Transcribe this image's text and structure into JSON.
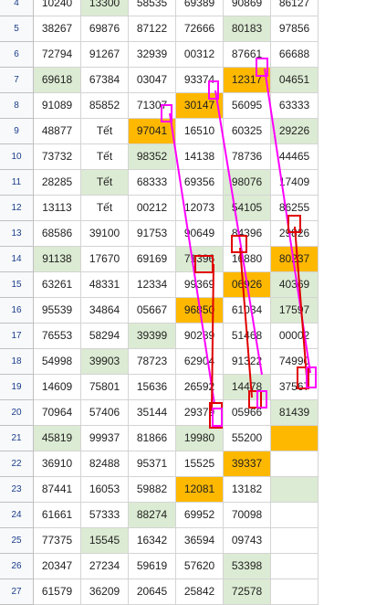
{
  "row_numbers": [
    "4",
    "5",
    "6",
    "7",
    "8",
    "9",
    "10",
    "11",
    "12",
    "13",
    "14",
    "15",
    "16",
    "17",
    "18",
    "19",
    "20",
    "21",
    "22",
    "23",
    "24",
    "25",
    "26",
    "27"
  ],
  "rows": [
    [
      "10240",
      "13300",
      "58535",
      "69389",
      "90869",
      "86127"
    ],
    [
      "38267",
      "69876",
      "87122",
      "72666",
      "80183",
      "97856"
    ],
    [
      "72794",
      "91267",
      "32939",
      "00312",
      "87661",
      "66688"
    ],
    [
      "69618",
      "67384",
      "03047",
      "93374",
      "12317",
      "04651"
    ],
    [
      "91089",
      "85852",
      "71307",
      "30147",
      "56095",
      "63333"
    ],
    [
      "48877",
      "Tết",
      "97041",
      "16510",
      "60325",
      "29226"
    ],
    [
      "73732",
      "Tết",
      "98352",
      "14138",
      "78736",
      "44465"
    ],
    [
      "28285",
      "Tết",
      "68333",
      "69356",
      "98076",
      "17409"
    ],
    [
      "13113",
      "Tết",
      "00212",
      "12073",
      "54105",
      "86255"
    ],
    [
      "68586",
      "39100",
      "91753",
      "90649",
      "84396",
      "29826"
    ],
    [
      "91138",
      "17670",
      "69169",
      "71396",
      "16880",
      "80237"
    ],
    [
      "63261",
      "48331",
      "12334",
      "99369",
      "06926",
      "40369"
    ],
    [
      "95539",
      "34864",
      "05667",
      "96850",
      "61034",
      "17597"
    ],
    [
      "76553",
      "58294",
      "39399",
      "90289",
      "51468",
      "00002"
    ],
    [
      "54998",
      "39903",
      "78723",
      "62904",
      "91322",
      "74990"
    ],
    [
      "14609",
      "75801",
      "15636",
      "26592",
      "14478",
      "37567"
    ],
    [
      "70964",
      "57406",
      "35144",
      "29379",
      "05966",
      "81439"
    ],
    [
      "45819",
      "99937",
      "81866",
      "19980",
      "55200",
      ""
    ],
    [
      "36910",
      "82488",
      "95371",
      "15525",
      "39337",
      ""
    ],
    [
      "87441",
      "16053",
      "59882",
      "12081",
      "13182",
      ""
    ],
    [
      "61661",
      "57333",
      "88274",
      "69952",
      "70098",
      ""
    ],
    [
      "77375",
      "15545",
      "16342",
      "36594",
      "09743",
      ""
    ],
    [
      "20347",
      "27234",
      "59619",
      "57620",
      "53398",
      ""
    ],
    [
      "61579",
      "36209",
      "20645",
      "25842",
      "72578",
      ""
    ]
  ],
  "colors": {
    "green_fill": "#dcebd3",
    "orange_fill": "#ffb800",
    "red_box": "#e00000",
    "magenta_box": "#ff00ff",
    "row_header_text": "#1a3e8c"
  }
}
